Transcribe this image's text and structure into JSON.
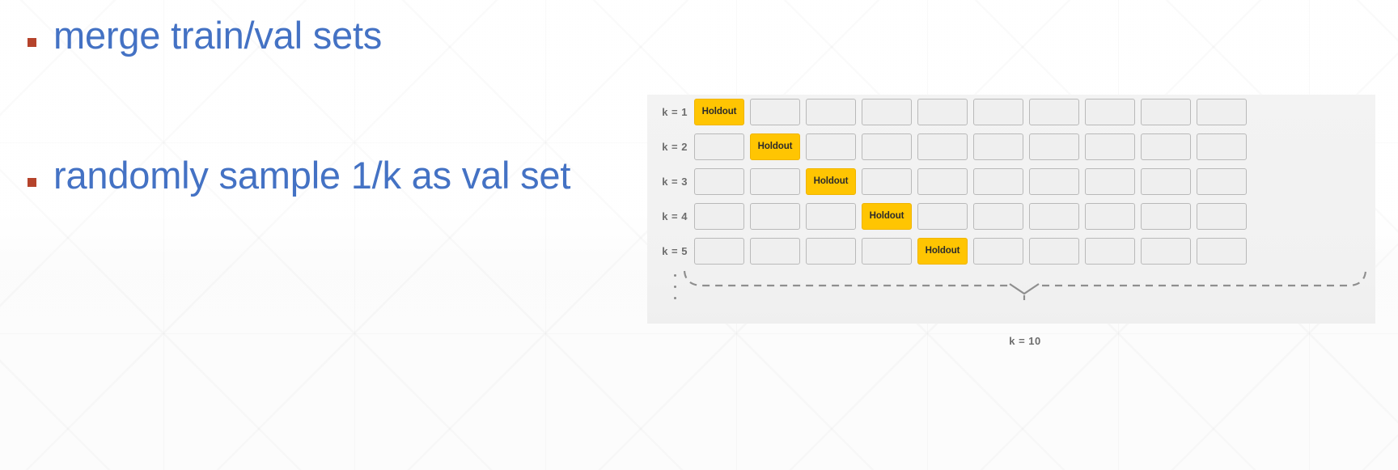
{
  "slide": {
    "background_color": "#fdfdfd",
    "bullet_text_color": "#4472C4",
    "bullet_marker_color": "#B5432B"
  },
  "bullets": [
    {
      "text": "merge train/val sets"
    },
    {
      "text": "randomly sample 1/k as val set"
    }
  ],
  "kfold_diagram": {
    "panel_background": "#f1f1f1",
    "holdout_color": "#FFC502",
    "cell_color": "#efefef",
    "cell_border_color": "#b9b9b9",
    "columns": 10,
    "holdout_label": "Holdout",
    "total_label": "k = 10",
    "ellipsis_dots": 3,
    "rows": [
      {
        "label": "k = 1",
        "holdout_index": 0
      },
      {
        "label": "k = 2",
        "holdout_index": 1
      },
      {
        "label": "k = 3",
        "holdout_index": 2
      },
      {
        "label": "k = 4",
        "holdout_index": 3
      },
      {
        "label": "k = 5",
        "holdout_index": 4
      }
    ]
  }
}
